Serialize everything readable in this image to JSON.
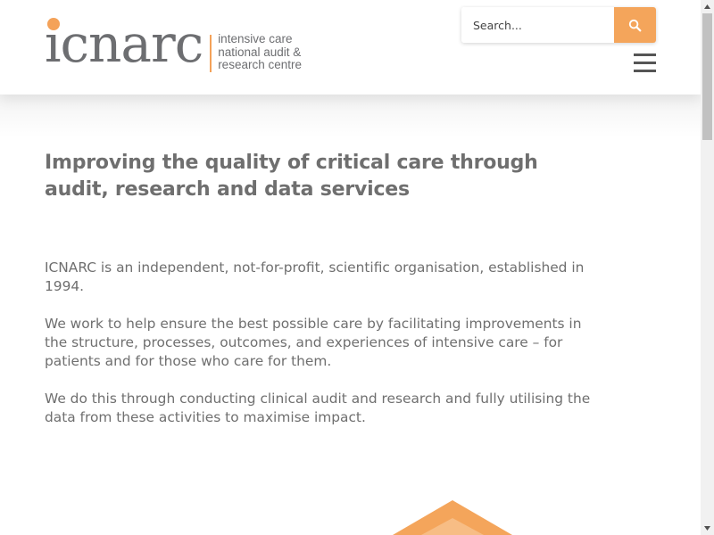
{
  "header": {
    "logo": {
      "wordmark": "icnarc",
      "tagline": [
        "intensive care",
        "national audit &",
        "research centre"
      ]
    },
    "search": {
      "placeholder": "Search...",
      "button_icon": "search-icon"
    },
    "menu_icon": "hamburger-menu-icon"
  },
  "main": {
    "headline": "Improving the quality of critical care through audit, research and data services",
    "paragraphs": [
      "ICNARC is an independent, not-for-profit, scientific organisation, established in 1994.",
      "We work to help ensure the best possible care by facilitating improvements in the structure, processes, outcomes, and experiences of intensive care – for patients and for those who care for them.",
      "We do this through conducting clinical audit and research and fully utilising the data from these activities to maximise impact."
    ]
  },
  "colors": {
    "accent": "#f4a55b",
    "text": "#6f6f6f",
    "logo_grey": "#6d6e71"
  }
}
